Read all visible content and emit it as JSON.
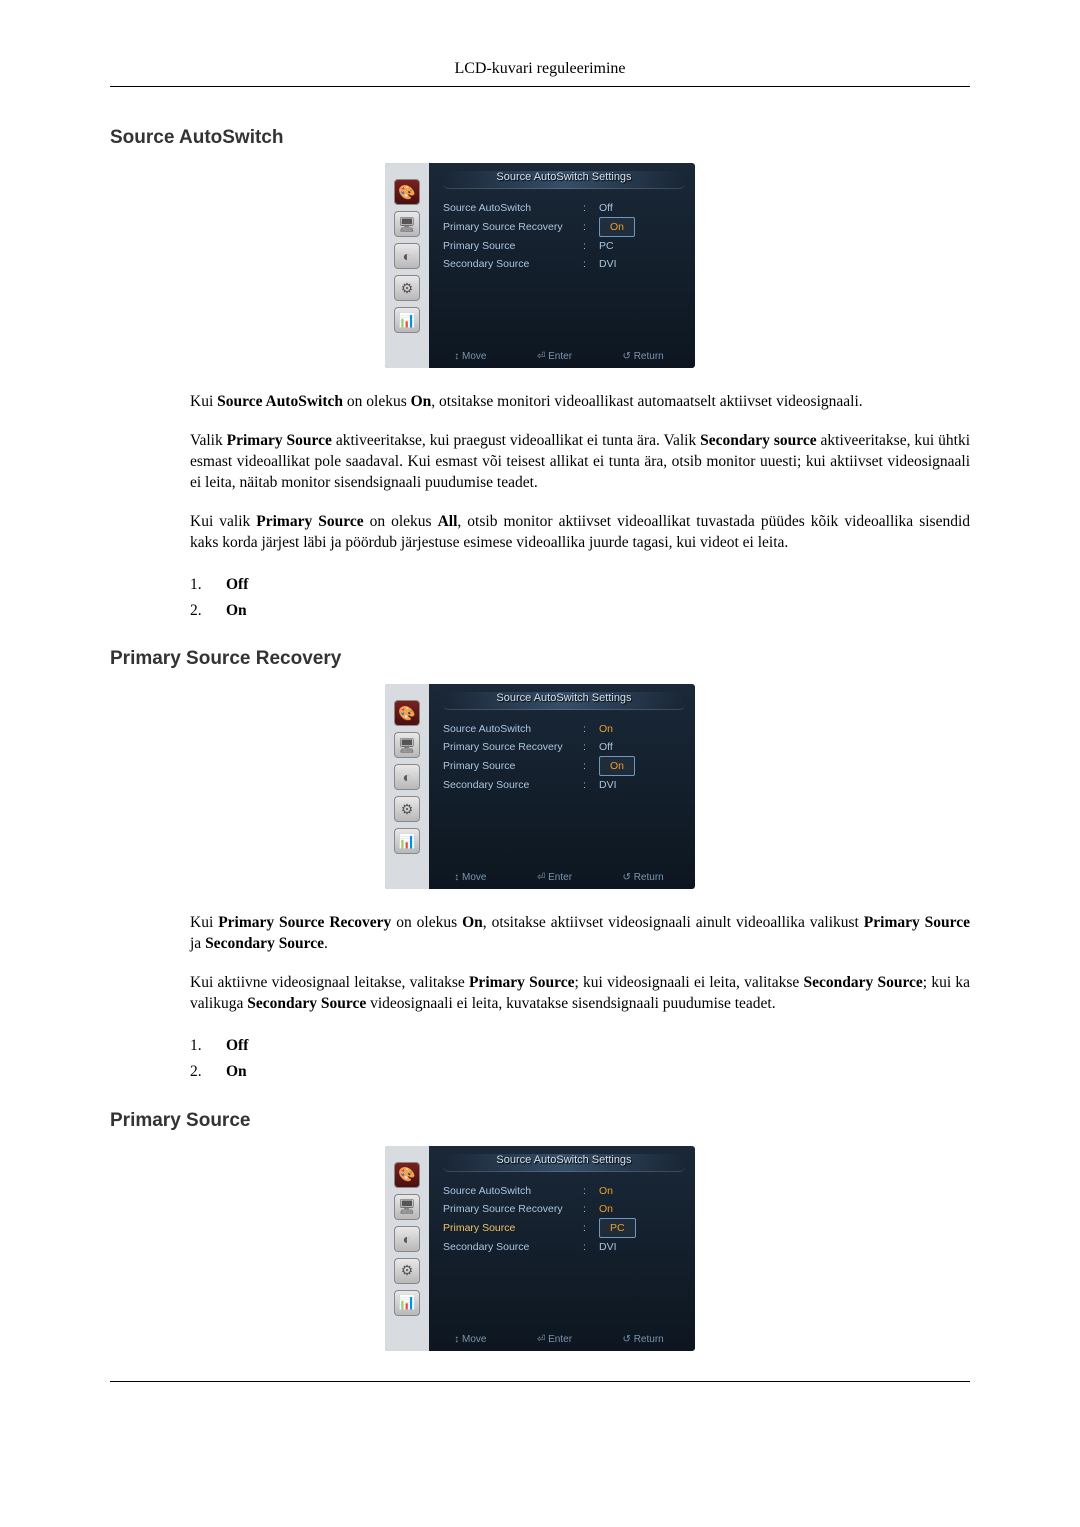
{
  "pageHeader": "LCD-kuvari reguleerimine",
  "sections": [
    {
      "heading": "Source AutoSwitch",
      "osd": {
        "title": "Source AutoSwitch Settings",
        "rows": [
          {
            "label": "Source AutoSwitch",
            "value": "Off",
            "labelHL": false,
            "valHL": false,
            "valBox": false
          },
          {
            "label": "Primary Source Recovery",
            "value": "On",
            "labelHL": false,
            "valHL": true,
            "valBox": true
          },
          {
            "label": "Primary Source",
            "value": "PC",
            "labelHL": false,
            "valHL": false,
            "valBox": false
          },
          {
            "label": "Secondary Source",
            "value": "DVI",
            "labelHL": false,
            "valHL": false,
            "valBox": false
          }
        ],
        "footer": {
          "move": "Move",
          "enter": "Enter",
          "return": "Return"
        }
      },
      "paragraphs": [
        [
          {
            "t": "Kui ",
            "b": false
          },
          {
            "t": "Source AutoSwitch",
            "b": true
          },
          {
            "t": " on olekus ",
            "b": false
          },
          {
            "t": "On",
            "b": true
          },
          {
            "t": ", otsitakse monitori videoallikast automaatselt aktiivset video­signaali.",
            "b": false
          }
        ],
        [
          {
            "t": "Valik ",
            "b": false
          },
          {
            "t": "Primary Source",
            "b": true
          },
          {
            "t": " aktiveeritakse, kui praegust videoallikat ei tunta ära. Valik ",
            "b": false
          },
          {
            "t": "Secondary source",
            "b": true
          },
          {
            "t": " aktiveeritakse, kui ühtki esmast videoallikat pole saadaval. Kui esmast või teisest allikat ei tunta ära, otsib monitor uuesti; kui aktiivset videosignaali ei leita, näitab monitor sisendsignaali puudumise teadet.",
            "b": false
          }
        ],
        [
          {
            "t": "Kui valik ",
            "b": false
          },
          {
            "t": "Primary Source",
            "b": true
          },
          {
            "t": " on olekus ",
            "b": false
          },
          {
            "t": "All",
            "b": true
          },
          {
            "t": ", otsib monitor aktiivset videoallikat tuvastada püüdes kõik videoallika sisendid kaks korda järjest läbi ja pöördub järjestuse esimese videoallika juurde tagasi, kui videot ei leita.",
            "b": false
          }
        ]
      ],
      "list": [
        "Off",
        "On"
      ]
    },
    {
      "heading": "Primary Source Recovery",
      "osd": {
        "title": "Source AutoSwitch Settings",
        "rows": [
          {
            "label": "Source AutoSwitch",
            "value": "On",
            "labelHL": false,
            "valHL": true,
            "valBox": false
          },
          {
            "label": "Primary Source Recovery",
            "value": "Off",
            "labelHL": false,
            "valHL": false,
            "valBox": false
          },
          {
            "label": "Primary Source",
            "value": "On",
            "labelHL": false,
            "valHL": true,
            "valBox": true
          },
          {
            "label": "Secondary Source",
            "value": "DVI",
            "labelHL": false,
            "valHL": false,
            "valBox": false
          }
        ],
        "footer": {
          "move": "Move",
          "enter": "Enter",
          "return": "Return"
        }
      },
      "paragraphs": [
        [
          {
            "t": "Kui ",
            "b": false
          },
          {
            "t": "Primary Source Recovery",
            "b": true
          },
          {
            "t": " on olekus ",
            "b": false
          },
          {
            "t": "On",
            "b": true
          },
          {
            "t": ", otsitakse aktiivset videosignaali ainult videoallika valikust ",
            "b": false
          },
          {
            "t": "Primary Source",
            "b": true
          },
          {
            "t": " ja ",
            "b": false
          },
          {
            "t": "Secondary Source",
            "b": true
          },
          {
            "t": ".",
            "b": false
          }
        ],
        [
          {
            "t": "Kui aktiivne videosignaal leitakse, valitakse ",
            "b": false
          },
          {
            "t": "Primary Source",
            "b": true
          },
          {
            "t": "; kui videosignaali ei leita, valitakse ",
            "b": false
          },
          {
            "t": "Secondary Source",
            "b": true
          },
          {
            "t": "; kui ka valikuga ",
            "b": false
          },
          {
            "t": "Secondary Source",
            "b": true
          },
          {
            "t": " videosignaali ei leita, kuvatakse sisendsignaali puudumise teadet.",
            "b": false
          }
        ]
      ],
      "list": [
        "Off",
        "On"
      ]
    },
    {
      "heading": "Primary Source",
      "osd": {
        "title": "Source AutoSwitch Settings",
        "rows": [
          {
            "label": "Source AutoSwitch",
            "value": "On",
            "labelHL": false,
            "valHL": true,
            "valBox": false
          },
          {
            "label": "Primary Source Recovery",
            "value": "On",
            "labelHL": false,
            "valHL": true,
            "valBox": false
          },
          {
            "label": "Primary Source",
            "value": "PC",
            "labelHL": true,
            "valHL": true,
            "valBox": true
          },
          {
            "label": "Secondary Source",
            "value": "DVI",
            "labelHL": false,
            "valHL": false,
            "valBox": false
          }
        ],
        "footer": {
          "move": "Move",
          "enter": "Enter",
          "return": "Return"
        }
      },
      "paragraphs": [],
      "list": []
    }
  ],
  "iconGlyphs": [
    "🎨",
    "🖥",
    "◐",
    "⚙",
    "📊"
  ]
}
